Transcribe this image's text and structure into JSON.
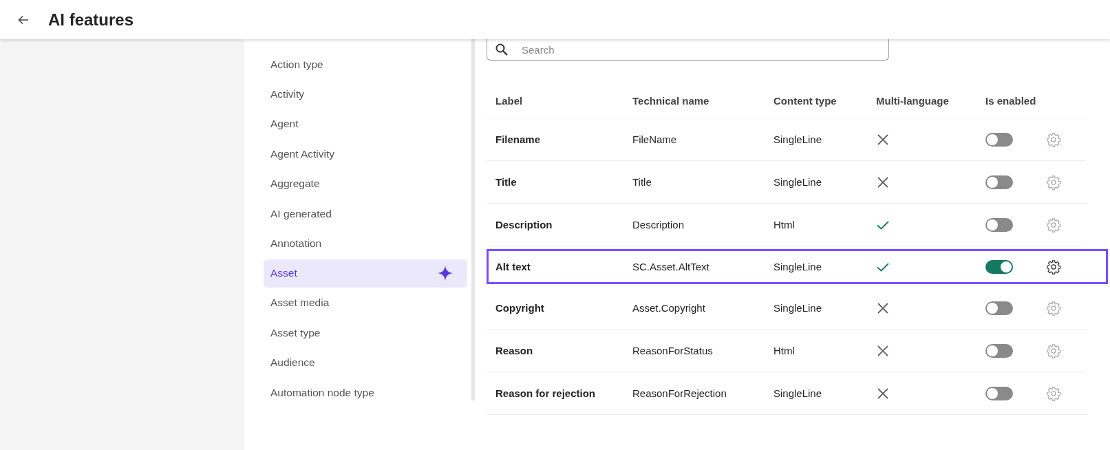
{
  "header": {
    "title": "AI features"
  },
  "sidebar": {
    "items": [
      {
        "label": "Action type",
        "selected": false,
        "ai": false
      },
      {
        "label": "Activity",
        "selected": false,
        "ai": false
      },
      {
        "label": "Agent",
        "selected": false,
        "ai": false
      },
      {
        "label": "Agent Activity",
        "selected": false,
        "ai": false
      },
      {
        "label": "Aggregate",
        "selected": false,
        "ai": false
      },
      {
        "label": "AI generated",
        "selected": false,
        "ai": false
      },
      {
        "label": "Annotation",
        "selected": false,
        "ai": false
      },
      {
        "label": "Asset",
        "selected": true,
        "ai": true
      },
      {
        "label": "Asset media",
        "selected": false,
        "ai": false
      },
      {
        "label": "Asset type",
        "selected": false,
        "ai": false
      },
      {
        "label": "Audience",
        "selected": false,
        "ai": false
      },
      {
        "label": "Automation node type",
        "selected": false,
        "ai": false
      }
    ]
  },
  "search": {
    "placeholder": "Search"
  },
  "table": {
    "columns": [
      "Label",
      "Technical name",
      "Content type",
      "Multi-language",
      "Is enabled"
    ],
    "rows": [
      {
        "label": "Filename",
        "technical_name": "FileName",
        "content_type": "SingleLine",
        "multi_language": false,
        "enabled": false,
        "selected": false
      },
      {
        "label": "Title",
        "technical_name": "Title",
        "content_type": "SingleLine",
        "multi_language": false,
        "enabled": false,
        "selected": false
      },
      {
        "label": "Description",
        "technical_name": "Description",
        "content_type": "Html",
        "multi_language": true,
        "enabled": false,
        "selected": false
      },
      {
        "label": "Alt text",
        "technical_name": "SC.Asset.AltText",
        "content_type": "SingleLine",
        "multi_language": true,
        "enabled": true,
        "selected": true
      },
      {
        "label": "Copyright",
        "technical_name": "Asset.Copyright",
        "content_type": "SingleLine",
        "multi_language": false,
        "enabled": false,
        "selected": false
      },
      {
        "label": "Reason",
        "technical_name": "ReasonForStatus",
        "content_type": "Html",
        "multi_language": false,
        "enabled": false,
        "selected": false
      },
      {
        "label": "Reason for rejection",
        "technical_name": "ReasonForRejection",
        "content_type": "SingleLine",
        "multi_language": false,
        "enabled": false,
        "selected": false
      }
    ]
  }
}
